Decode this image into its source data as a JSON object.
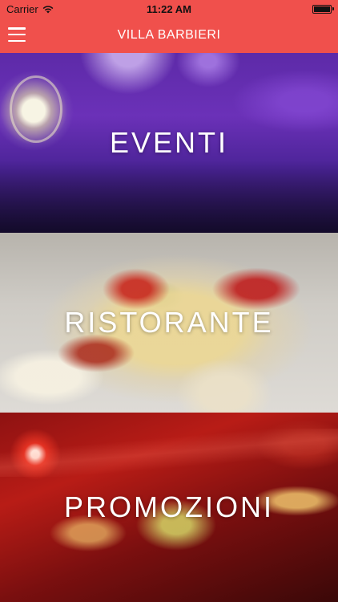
{
  "status_bar": {
    "carrier": "Carrier",
    "time": "11:22 AM"
  },
  "nav": {
    "title": "VILLA BARBIERI",
    "menu_icon": "hamburger-icon"
  },
  "panels": [
    {
      "label": "EVENTI"
    },
    {
      "label": "RISTORANTE"
    },
    {
      "label": "PROMOZIONI"
    }
  ],
  "colors": {
    "nav_bar": "#f0504c",
    "nav_text": "#ffffff"
  }
}
